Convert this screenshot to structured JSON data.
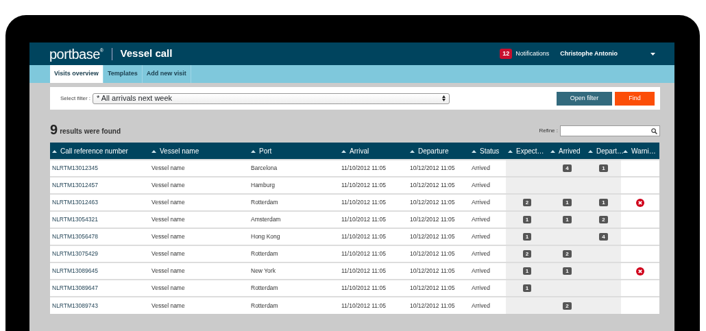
{
  "app": {
    "logo": "portbase$^{®}$",
    "title": "Vessel call"
  },
  "header": {
    "notification_count": "12",
    "notifications_label": "Notifications",
    "user_name": "Christophe Antonio"
  },
  "tabs": [
    {
      "label": "Visits overview",
      "selected": true
    },
    {
      "label": "Templates",
      "selected": false
    },
    {
      "label": "Add new visit",
      "selected": false
    }
  ],
  "filter": {
    "label": "Select filter :",
    "value": "* All arrivals next week",
    "buttons": [
      {
        "label": "Open filter",
        "kind": "secondary"
      },
      {
        "label": "Find",
        "kind": "primary"
      }
    ]
  },
  "results": {
    "count": "9",
    "text": "results were found",
    "refine_label": "Refine :"
  },
  "table": {
    "columns": [
      "Call reference number",
      "Vessel name",
      "Port",
      "Arrival",
      "Departure",
      "Status",
      "Expect…",
      "Arrived",
      "Depart…",
      "Warni…"
    ],
    "rows": [
      {
        "call_ref": "NLRTM13012345",
        "vessel": "Vessel name",
        "port": "Barcelona",
        "arrival": "11/10/2012 11:05",
        "departure": "10/12/2012 11:05",
        "status": "Arrived",
        "expected": null,
        "arrived": "4",
        "departed": "1",
        "warning": false
      },
      {
        "call_ref": "NLRTM13012457",
        "vessel": "Vessel name",
        "port": "Hamburg",
        "arrival": "11/10/2012 11:05",
        "departure": "10/12/2012 11:05",
        "status": "Arrived",
        "expected": null,
        "arrived": null,
        "departed": null,
        "warning": false
      },
      {
        "call_ref": "NLRTM13012463",
        "vessel": "Vessel name",
        "port": "Rotterdam",
        "arrival": "11/10/2012 11:05",
        "departure": "10/12/2012 11:05",
        "status": "Arrived",
        "expected": "2",
        "arrived": "1",
        "departed": "1",
        "warning": true
      },
      {
        "call_ref": "NLRTM13054321",
        "vessel": "Vessel name",
        "port": "Amsterdam",
        "arrival": "11/10/2012 11:05",
        "departure": "10/12/2012 11:05",
        "status": "Arrived",
        "expected": "1",
        "arrived": "1",
        "departed": "2",
        "warning": false
      },
      {
        "call_ref": "NLRTM13056478",
        "vessel": "Vessel name",
        "port": "Hong Kong",
        "arrival": "11/10/2012 11:05",
        "departure": "10/12/2012 11:05",
        "status": "Arrived",
        "expected": "1",
        "arrived": null,
        "departed": "4",
        "warning": false
      },
      {
        "call_ref": "NLRTM13075429",
        "vessel": "Vessel name",
        "port": "Rotterdam",
        "arrival": "11/10/2012 11:05",
        "departure": "10/12/2012 11:05",
        "status": "Arrived",
        "expected": "2",
        "arrived": "2",
        "departed": null,
        "warning": false
      },
      {
        "call_ref": "NLRTM13089645",
        "vessel": "Vessel name",
        "port": "New York",
        "arrival": "11/10/2012 11:05",
        "departure": "10/12/2012 11:05",
        "status": "Arrived",
        "expected": "1",
        "arrived": "1",
        "departed": null,
        "warning": true
      },
      {
        "call_ref": "NLRTM13089647",
        "vessel": "Vessel name",
        "port": "Rotterdam",
        "arrival": "11/10/2012 11:05",
        "departure": "10/12/2012 11:05",
        "status": "Arrived",
        "expected": "1",
        "arrived": null,
        "departed": null,
        "warning": false
      },
      {
        "call_ref": "NLRTM13089743",
        "vessel": "Vessel name",
        "port": "Rotterdam",
        "arrival": "11/10/2012 11:05",
        "departure": "10/12/2012 11:05",
        "status": "Arrived",
        "expected": null,
        "arrived": "2",
        "departed": null,
        "warning": false
      }
    ]
  }
}
